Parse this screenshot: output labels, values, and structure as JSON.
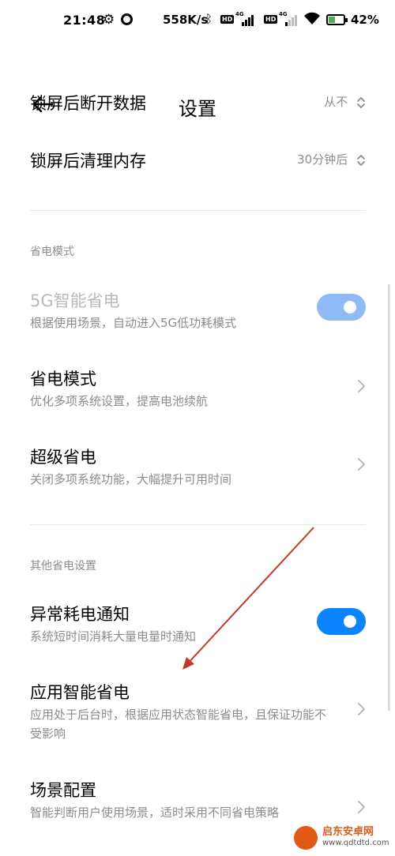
{
  "status_bar": {
    "time": "21:48",
    "net_speed": "558K/s",
    "hd1": "HD",
    "hd2": "HD",
    "sig1_label": "4G",
    "sig2_label": "4G",
    "battery_percent": "42%",
    "battery_level": 0.42,
    "icons": [
      "gear-icon",
      "ring-icon",
      "bluetooth-icon",
      "signal-icon",
      "wifi-icon",
      "battery-icon"
    ]
  },
  "header": {
    "title": "设置"
  },
  "rows_top": [
    {
      "title": "锁屏后断开数据",
      "value": "从不"
    },
    {
      "title": "锁屏后清理内存",
      "value": "30分钟后"
    }
  ],
  "section_power": {
    "label": "省电模式",
    "items": [
      {
        "title": "5G智能省电",
        "subtitle": "根据使用场景，自动进入5G低功耗模式",
        "toggle": true,
        "disabled": true
      },
      {
        "title": "省电模式",
        "subtitle": "优化多项系统设置，提高电池续航"
      },
      {
        "title": "超级省电",
        "subtitle": "关闭多项系统功能，大幅提升可用时间"
      }
    ]
  },
  "section_other": {
    "label": "其他省电设置",
    "items": [
      {
        "title": "异常耗电通知",
        "subtitle": "系统短时间消耗大量电量时通知",
        "toggle": true
      },
      {
        "title": "应用智能省电",
        "subtitle": "应用处于后台时，根据应用状态智能省电，且保证功能不受影响"
      },
      {
        "title": "场景配置",
        "subtitle": "智能判断用户使用场景，适时采用不同省电策略"
      }
    ]
  },
  "watermark": {
    "name": "启东安卓网",
    "url": "www.qdtdtd.com"
  },
  "colors": {
    "accent": "#0d84ff",
    "accent_disabled": "#8fbaf5",
    "annotation_arrow": "#c0392b",
    "watermark": "#e05a16"
  }
}
